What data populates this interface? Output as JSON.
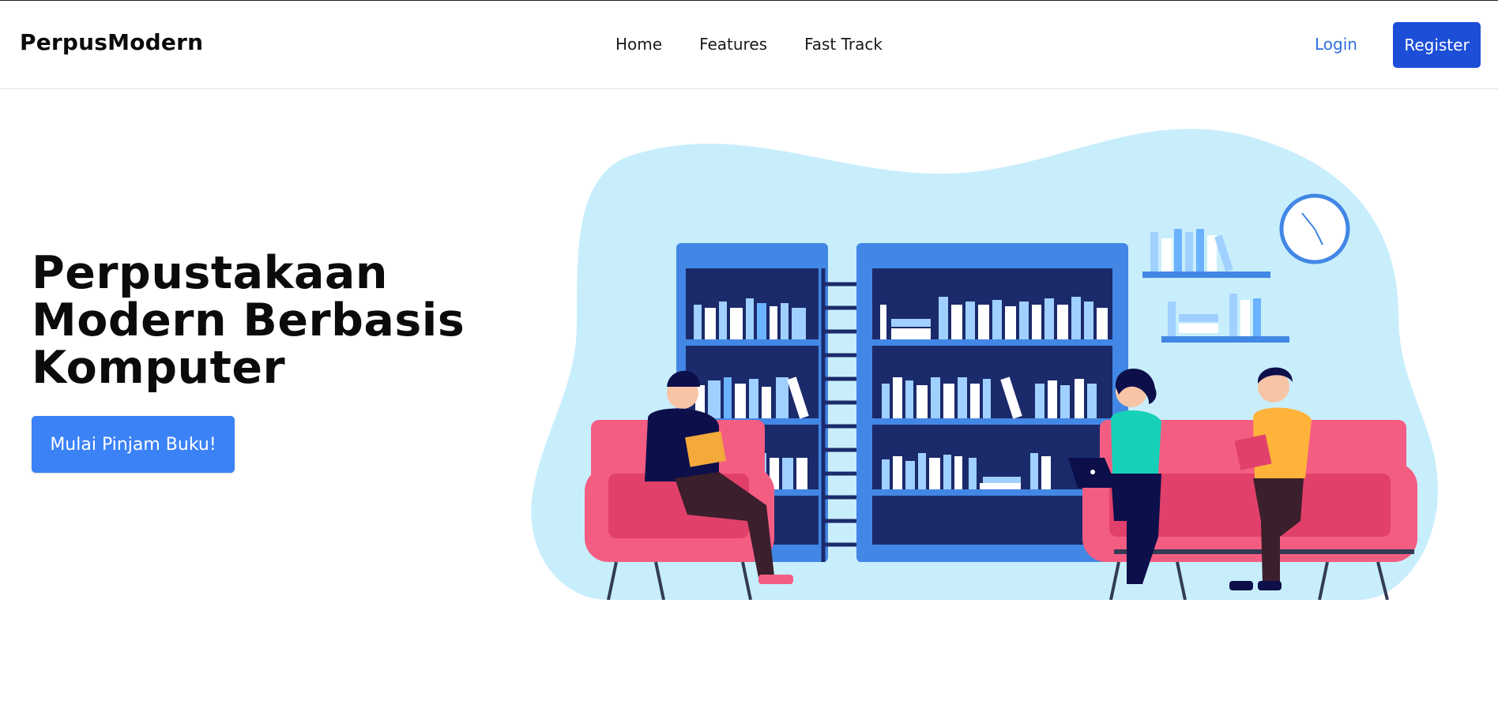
{
  "navbar": {
    "brand": "PerpusModern",
    "links": [
      "Home",
      "Features",
      "Fast Track"
    ],
    "login": "Login",
    "register": "Register"
  },
  "hero": {
    "title_lines": [
      "Perpustakaan",
      "Modern Berbasis",
      "Komputer"
    ],
    "cta": "Mulai Pinjam Buku!"
  },
  "illustration": {
    "name": "library-reading-illustration",
    "colors": {
      "blob": "#c8eefc",
      "shelf": "#4287e5",
      "shelf_inner": "#1b2a6b",
      "sofa": "#f45d82",
      "sofa_dark": "#e0406a",
      "clock": "#4287e5"
    }
  }
}
